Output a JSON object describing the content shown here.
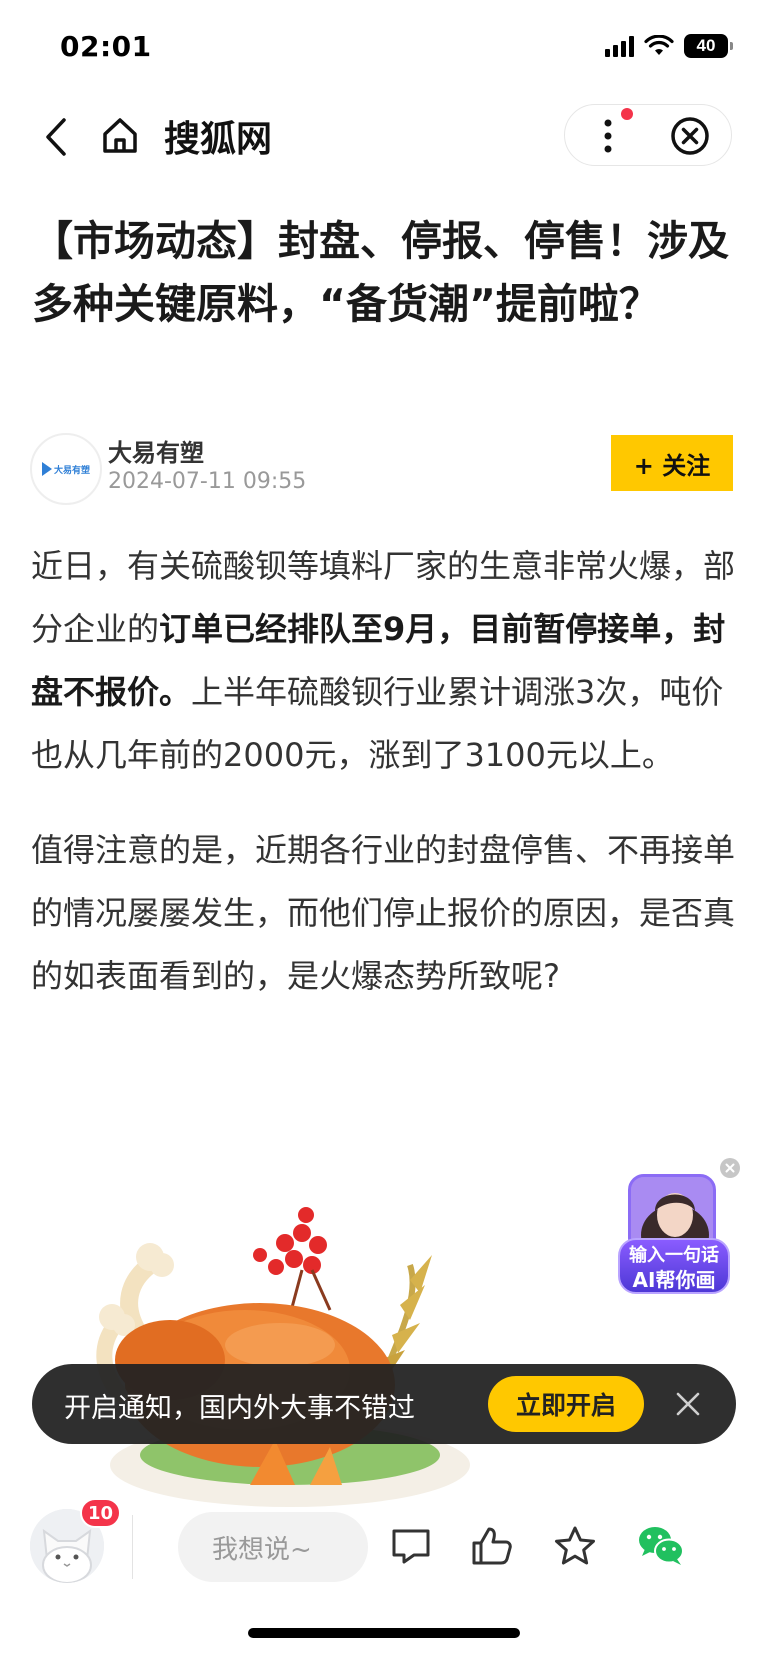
{
  "status_bar": {
    "time": "02:01",
    "battery": "40"
  },
  "nav": {
    "title": "搜狐网"
  },
  "article": {
    "title": "【市场动态】封盘、停报、停售！涉及多种关键原料，“备货潮”提前啦？",
    "author": {
      "name": "大易有塑",
      "date": "2024-07-11 09:55",
      "logo_text": "大易有塑"
    },
    "follow_label": "+ 关注",
    "p1_a": "近日，有关硫酸钡等填料厂家的生意非常火爆，部分企业的",
    "p1_b": "订单已经排队至9月，目前暂停接单，封盘不报价。",
    "p1_c": "上半年硫酸钡行业累计调涨3次，吨价也从几年前的2000元，涨到了3100元以上。",
    "p2": "值得注意的是，近期各行业的封盘停售、不再接单的情况屡屡发生，而他们停止报价的原因，是否真的如表面看到的，是火爆态势所致呢?"
  },
  "ai_widget": {
    "line1": "输入一句话",
    "line2": "AI帮你画"
  },
  "notify": {
    "text": "开启通知，国内外大事不错过",
    "button": "立即开启"
  },
  "bottom_bar": {
    "badge": "10",
    "input_placeholder": "我想说~"
  },
  "colors": {
    "accent": "#ffc800",
    "alert": "#f4344a",
    "wechat": "#21c05f"
  }
}
